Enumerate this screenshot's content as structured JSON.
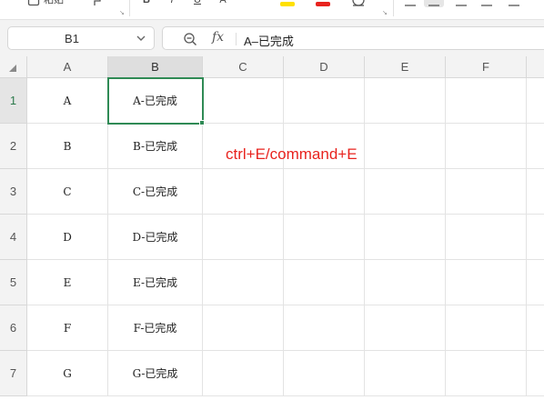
{
  "toolbar": {
    "items": [
      {
        "name": "paste-icon",
        "label": "粘贴"
      },
      {
        "name": "format-painter-icon",
        "label": ""
      },
      {
        "name": "bold-icon",
        "label": "B"
      },
      {
        "name": "italic-icon",
        "label": "I"
      },
      {
        "name": "underline-icon",
        "label": "U"
      },
      {
        "name": "strikethrough-icon",
        "label": "A"
      },
      {
        "name": "highlight-color-icon",
        "label": ""
      },
      {
        "name": "font-color-icon",
        "label": ""
      },
      {
        "name": "clear-format-icon",
        "label": ""
      },
      {
        "name": "align-left-icon",
        "label": ""
      },
      {
        "name": "align-center-icon",
        "label": ""
      },
      {
        "name": "align-right-icon",
        "label": ""
      },
      {
        "name": "align-justify-icon",
        "label": ""
      }
    ],
    "highlight_color": "#ffe000",
    "font_color": "#e8231e"
  },
  "name_box": {
    "value": "B1"
  },
  "formula_bar": {
    "fx_label": "fx",
    "value": "A–已完成"
  },
  "columns": [
    "A",
    "B",
    "C",
    "D",
    "E",
    "F"
  ],
  "active_column": "B",
  "rows": [
    {
      "number": "1",
      "a": "A",
      "b": "A-已完成"
    },
    {
      "number": "2",
      "a": "B",
      "b": "B-已完成"
    },
    {
      "number": "3",
      "a": "C",
      "b": "C-已完成"
    },
    {
      "number": "4",
      "a": "D",
      "b": "D-已完成"
    },
    {
      "number": "5",
      "a": "E",
      "b": "E-已完成"
    },
    {
      "number": "6",
      "a": "F",
      "b": "F-已完成"
    },
    {
      "number": "7",
      "a": "G",
      "b": "G-已完成"
    }
  ],
  "active_row": "1",
  "annotation": {
    "text": "ctrl+E/command+E",
    "color": "#e8231e"
  },
  "colors": {
    "selection": "#2f8a55",
    "header_bg": "#f3f3f3"
  }
}
